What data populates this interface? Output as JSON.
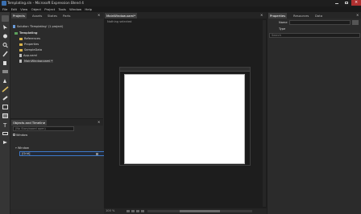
{
  "title_bar": {
    "title": "Templating.sln - Microsoft Expression Blend 4"
  },
  "menu": [
    "File",
    "Edit",
    "View",
    "Object",
    "Project",
    "Tools",
    "Window",
    "Help"
  ],
  "projects_panel": {
    "tabs": [
      "Projects",
      "Assets",
      "States",
      "Parts"
    ],
    "solution_label": "Solution 'Templating' (1 project)",
    "items": [
      "Templating",
      "References",
      "Properties",
      "SampleData",
      "App.xaml",
      "MainWindow.xaml *"
    ]
  },
  "objects_panel": {
    "title": "Objects and Timeline",
    "search_placeholder": "(No Storyboard open)",
    "window_label": "Window",
    "tree_items": [
      "Window",
      "[Grid]"
    ]
  },
  "document": {
    "tab_label": "MainWindow.xaml*",
    "breadcrumb": "Nothing selected",
    "zoom": "100 %"
  },
  "properties_panel": {
    "tabs": [
      "Properties",
      "Resources",
      "Data"
    ],
    "name_label": "Name",
    "name_value": "",
    "type_label": "Type",
    "type_value": "",
    "search_placeholder": "Search"
  },
  "colors": {
    "accent": "#3d78c8",
    "folder": "#d8b24a",
    "canvas": "#ffffff"
  }
}
